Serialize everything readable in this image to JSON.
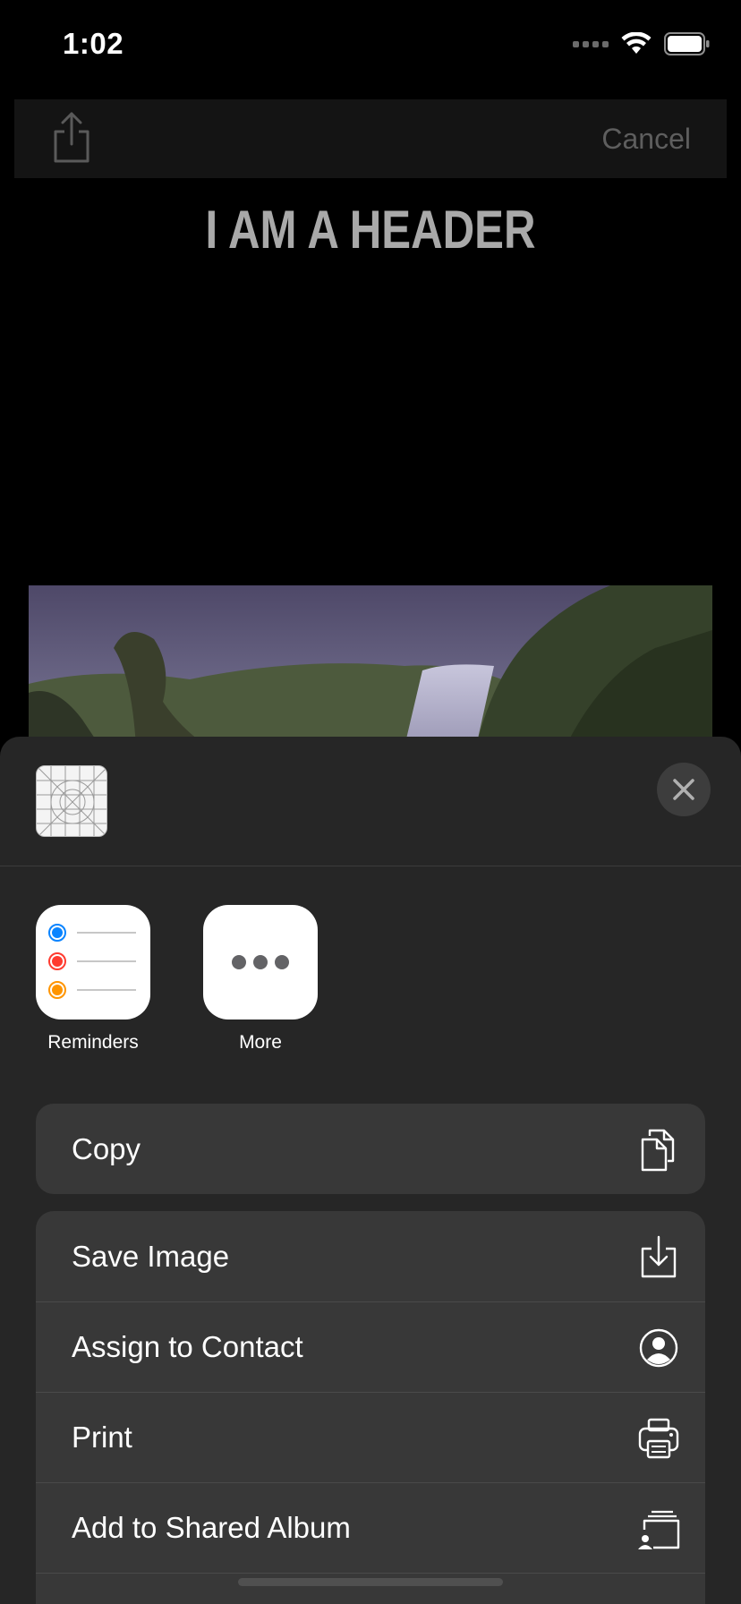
{
  "status_bar": {
    "time": "1:02"
  },
  "top_bar": {
    "cancel_label": "Cancel",
    "share_icon": "share-icon"
  },
  "page": {
    "header": "I AM A HEADER"
  },
  "share_sheet": {
    "apps": [
      {
        "label": "Reminders",
        "icon": "reminders-icon"
      },
      {
        "label": "More",
        "icon": "more-icon"
      }
    ],
    "actions_group1": [
      {
        "label": "Copy",
        "icon": "copy-icon"
      }
    ],
    "actions_group2": [
      {
        "label": "Save Image",
        "icon": "save-image-icon"
      },
      {
        "label": "Assign to Contact",
        "icon": "contact-icon"
      },
      {
        "label": "Print",
        "icon": "print-icon"
      },
      {
        "label": "Add to Shared Album",
        "icon": "shared-album-icon"
      }
    ]
  },
  "colors": {
    "background": "#000000",
    "sheet": "#262626",
    "row": "#383838",
    "header_text": "#a9a9a9",
    "cancel_text": "#5e5e5e"
  }
}
